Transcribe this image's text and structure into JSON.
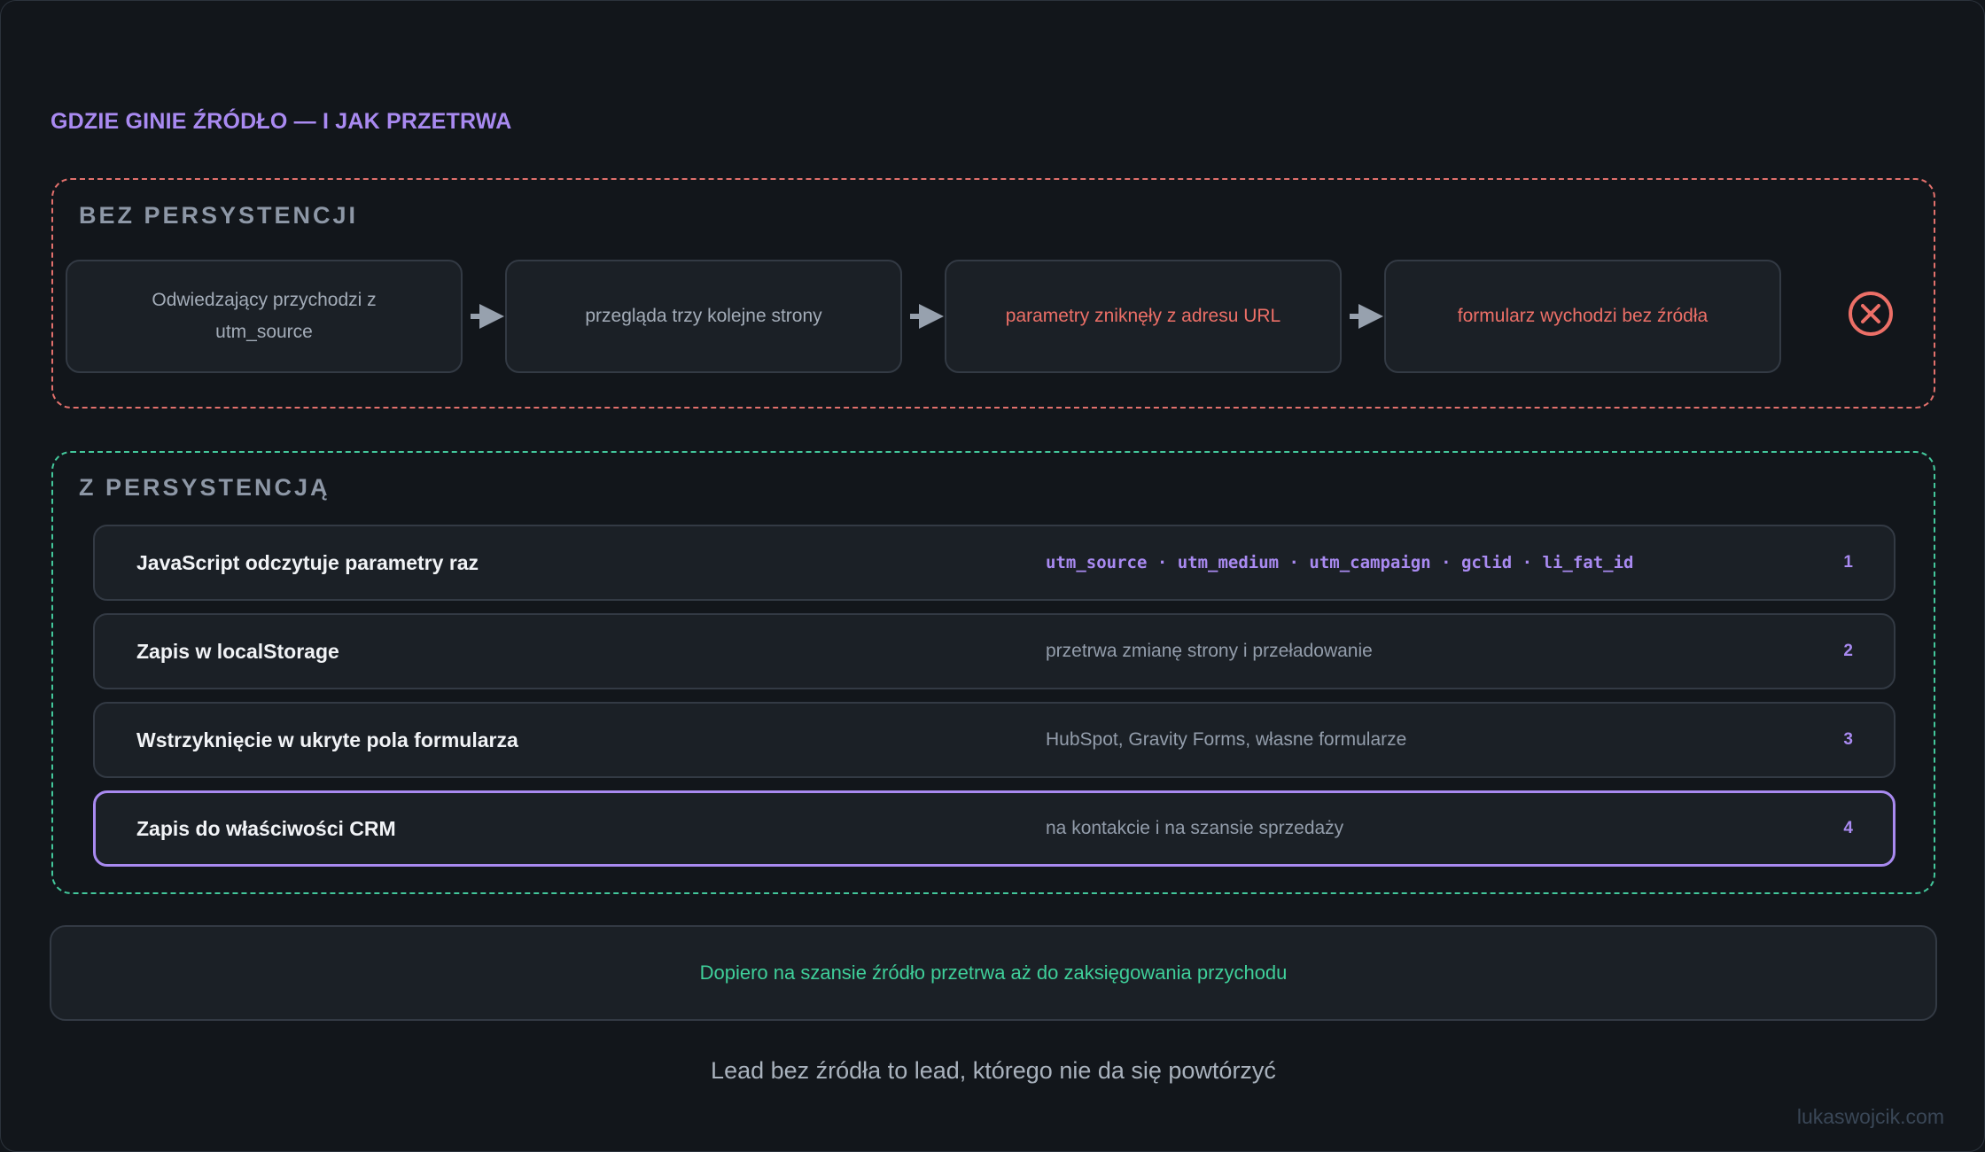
{
  "title": "GDZIE GINIE ŹRÓDŁO — I JAK PRZETRWA",
  "without": {
    "label": "BEZ PERSYSTENCJI",
    "steps": [
      {
        "text": "Odwiedzający przychodzi z utm_source",
        "status": "neutral"
      },
      {
        "text": "przegląda trzy kolejne strony",
        "status": "neutral"
      },
      {
        "text": "parametry zniknęły z adresu URL",
        "status": "bad"
      },
      {
        "text": "formularz wychodzi bez źródła",
        "status": "bad"
      }
    ],
    "end_icon": "x-circle-icon"
  },
  "with": {
    "label": "Z PERSYSTENCJĄ",
    "rows": [
      {
        "title": "JavaScript odczytuje parametry raz",
        "detail": "utm_source · utm_medium · utm_campaign · gclid · li_fat_id",
        "num": "1"
      },
      {
        "title": "Zapis w localStorage",
        "detail": "przetrwa zmianę strony i przeładowanie",
        "num": "2"
      },
      {
        "title": "Wstrzyknięcie w ukryte pola formularza",
        "detail": "HubSpot, Gravity Forms, własne formularze",
        "num": "3"
      },
      {
        "title": "Zapis do właściwości CRM",
        "detail": "na kontakcie i na szansie sprzedaży",
        "num": "4"
      }
    ]
  },
  "note": "Dopiero na szansie źródło przetrwa aż do zaksięgowania przychodu",
  "tagline": "Lead bez źródła to lead, którego nie da się powtórzyć",
  "footer": "lukaswojcik.com",
  "colors": {
    "accent": "#a98af1",
    "bad": "#ec6f67",
    "good": "#3fcf9a",
    "red_border": "#e2706c",
    "green_border": "#43c79b"
  }
}
